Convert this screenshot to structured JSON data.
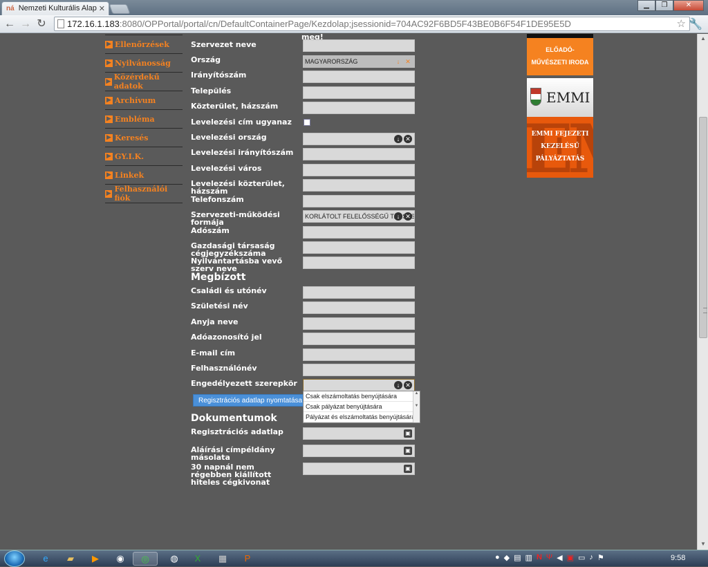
{
  "browser": {
    "tab_title": "Nemzeti Kulturális Alap",
    "tab_favicon": "ná",
    "url_host": "172.16.1.183",
    "url_path": ":8080/OPPortal/portal/cn/DefaultContainerPage/Kezdolap;jsessionid=704AC92F6BD5F43BE0B6F54F1DE95E5D"
  },
  "sidenav": {
    "items": [
      "Ellenőrzések",
      "Nyilvánosság",
      "Közérdekű adatok",
      "Archívum",
      "Embléma",
      "Keresés",
      "GY.I.K.",
      "Linkek",
      "Felhasználói fiók"
    ]
  },
  "form": {
    "top_fragment": "meg!",
    "org_name_label": "Szervezet neve",
    "country_label": "Ország",
    "country_value": "MAGYARORSZÁG",
    "zip_label": "Irányítószám",
    "city_label": "Település",
    "street_label": "Közterület, házszám",
    "mail_same_label": "Levelezési cím ugyanaz",
    "mail_country_label": "Levelezési ország",
    "mail_zip_label": "Levelezési irányítószám",
    "mail_city_label": "Levelezési város",
    "mail_street_label": "Levelezési közterület, házszám",
    "phone_label": "Telefonszám",
    "org_form_label": "Szervezeti-működési formája",
    "org_form_value": "KORLÁTOLT FELELŐSSÉGŰ TÁRSASÁG",
    "tax_label": "Adószám",
    "reg_no_label": "Gazdasági társaság cégjegyzékszáma",
    "registry_label": "Nyilvántartásba vevő szerv neve",
    "mandate_section": "Megbízott",
    "fullname_label": "Családi és utónév",
    "birthname_label": "Születési név",
    "mother_label": "Anyja neve",
    "taxid_label": "Adóazonosító jel",
    "email_label": "E-mail cím",
    "username_label": "Felhasználónév",
    "role_label": "Engedélyezett szerepkör",
    "role_options": [
      "Csak elszámoltatás benyújtására",
      "Csak pályázat benyújtására",
      "Pályázat és elszámoltatás benyújtására"
    ],
    "print_button": "Regisztrációs adatlap nyomtatása",
    "documents_section": "Dokumentumok",
    "doc1_label": "Regisztrációs adatlap",
    "doc2_label": "Aláírási címpéldány másolata",
    "doc3_label": "30 napnál nem régebben kiállított hiteles cégkivonat"
  },
  "banners": {
    "banner1_text": "ELŐADÓ-MŰVÉSZETI IRODA",
    "banner2_text": "EMMI",
    "banner3_lines": [
      "EMMI FEJEZETI",
      "KEZELÉSŰ",
      "PÁLYÁZTATÁS"
    ],
    "banner3_bg": "EM"
  },
  "taskbar": {
    "clock": "9:58"
  },
  "colors": {
    "accent": "#f58220",
    "page_bg": "#5a5a5a",
    "button_blue": "#4a90d9"
  }
}
